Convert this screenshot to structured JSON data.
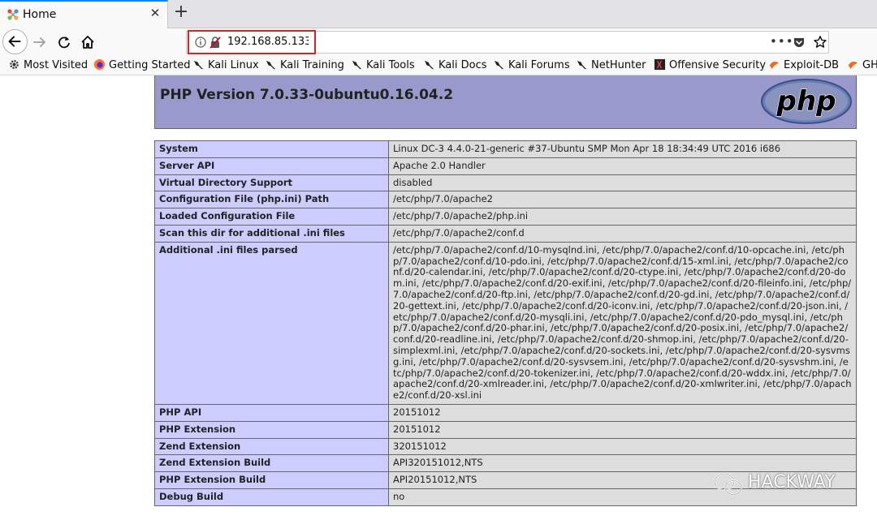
{
  "browser": {
    "tab": {
      "title": "Home"
    },
    "url": "192.168.85.133",
    "bookmarks": [
      {
        "label": "Most Visited",
        "icon": "gear-icon"
      },
      {
        "label": "Getting Started",
        "icon": "firefox-icon"
      },
      {
        "label": "Kali Linux",
        "icon": "kali-dragon-icon"
      },
      {
        "label": "Kali Training",
        "icon": "kali-dragon-icon"
      },
      {
        "label": "Kali Tools",
        "icon": "kali-dragon-icon"
      },
      {
        "label": "Kali Docs",
        "icon": "kali-dragon-icon"
      },
      {
        "label": "Kali Forums",
        "icon": "kali-dragon-icon"
      },
      {
        "label": "NetHunter",
        "icon": "kali-dragon-icon"
      },
      {
        "label": "Offensive Security",
        "icon": "offsec-icon"
      },
      {
        "label": "Exploit-DB",
        "icon": "exploitdb-icon"
      },
      {
        "label": "GH",
        "icon": "exploitdb-icon"
      }
    ]
  },
  "php": {
    "title": "PHP Version 7.0.33-0ubuntu0.16.04.2",
    "logo_text": "php",
    "rows": [
      {
        "key": "System",
        "value": "Linux DC-3 4.4.0-21-generic #37-Ubuntu SMP Mon Apr 18 18:34:49 UTC 2016 i686"
      },
      {
        "key": "Server API",
        "value": "Apache 2.0 Handler"
      },
      {
        "key": "Virtual Directory Support",
        "value": "disabled"
      },
      {
        "key": "Configuration File (php.ini) Path",
        "value": "/etc/php/7.0/apache2"
      },
      {
        "key": "Loaded Configuration File",
        "value": "/etc/php/7.0/apache2/php.ini"
      },
      {
        "key": "Scan this dir for additional .ini files",
        "value": "/etc/php/7.0/apache2/conf.d"
      },
      {
        "key": "Additional .ini files parsed",
        "value": "/etc/php/7.0/apache2/conf.d/10-mysqlnd.ini, /etc/php/7.0/apache2/conf.d/10-opcache.ini, /etc/php/7.0/apache2/conf.d/10-pdo.ini, /etc/php/7.0/apache2/conf.d/15-xml.ini, /etc/php/7.0/apache2/conf.d/20-calendar.ini, /etc/php/7.0/apache2/conf.d/20-ctype.ini, /etc/php/7.0/apache2/conf.d/20-dom.ini, /etc/php/7.0/apache2/conf.d/20-exif.ini, /etc/php/7.0/apache2/conf.d/20-fileinfo.ini, /etc/php/7.0/apache2/conf.d/20-ftp.ini, /etc/php/7.0/apache2/conf.d/20-gd.ini, /etc/php/7.0/apache2/conf.d/20-gettext.ini, /etc/php/7.0/apache2/conf.d/20-iconv.ini, /etc/php/7.0/apache2/conf.d/20-json.ini, /etc/php/7.0/apache2/conf.d/20-mysqli.ini, /etc/php/7.0/apache2/conf.d/20-pdo_mysql.ini, /etc/php/7.0/apache2/conf.d/20-phar.ini, /etc/php/7.0/apache2/conf.d/20-posix.ini, /etc/php/7.0/apache2/conf.d/20-readline.ini, /etc/php/7.0/apache2/conf.d/20-shmop.ini, /etc/php/7.0/apache2/conf.d/20-simplexml.ini, /etc/php/7.0/apache2/conf.d/20-sockets.ini, /etc/php/7.0/apache2/conf.d/20-sysvmsg.ini, /etc/php/7.0/apache2/conf.d/20-sysvsem.ini, /etc/php/7.0/apache2/conf.d/20-sysvshm.ini, /etc/php/7.0/apache2/conf.d/20-tokenizer.ini, /etc/php/7.0/apache2/conf.d/20-wddx.ini, /etc/php/7.0/apache2/conf.d/20-xmlreader.ini, /etc/php/7.0/apache2/conf.d/20-xmlwriter.ini, /etc/php/7.0/apache2/conf.d/20-xsl.ini"
      },
      {
        "key": "PHP API",
        "value": "20151012"
      },
      {
        "key": "PHP Extension",
        "value": "20151012"
      },
      {
        "key": "Zend Extension",
        "value": "320151012"
      },
      {
        "key": "Zend Extension Build",
        "value": "API320151012,NTS"
      },
      {
        "key": "PHP Extension Build",
        "value": "API20151012,NTS"
      },
      {
        "key": "Debug Build",
        "value": "no"
      }
    ]
  },
  "watermark": {
    "text": "HACKWAY"
  },
  "colors": {
    "header_bg": "#9999cc",
    "key_bg": "#ccccff",
    "value_bg": "#dddddd",
    "url_highlight": "#e02020"
  }
}
